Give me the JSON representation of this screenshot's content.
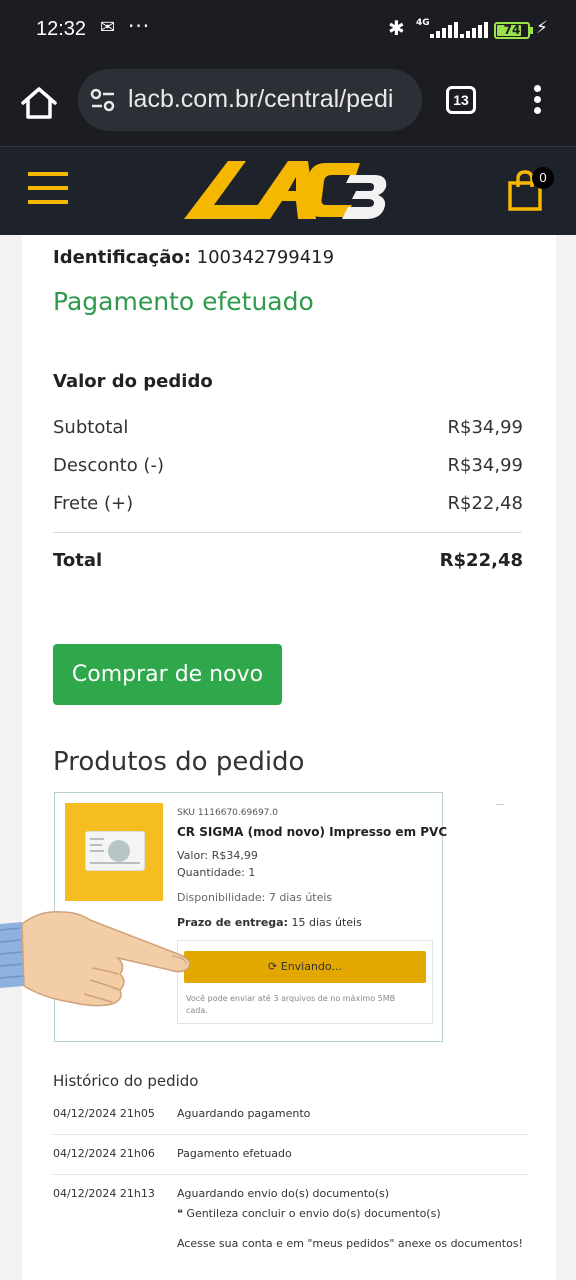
{
  "status_bar": {
    "time": "12:32",
    "network": "4G",
    "battery_level": "74",
    "battery_fraction": 0.74,
    "colors": {
      "background": "#1b1d22",
      "battery": "#9be34a"
    }
  },
  "browser": {
    "url": "lacb.com.br/central/pedi",
    "tab_count": "13"
  },
  "site_header": {
    "brand_color": "#f5b700",
    "cart_count": "0"
  },
  "order": {
    "identification_label": "Identificação:",
    "identification_value": "100342799419",
    "payment_status": "Pagamento efetuado",
    "summary_heading": "Valor do pedido",
    "rows": [
      {
        "label": "Subtotal",
        "value": "R$34,99"
      },
      {
        "label": "Desconto (-)",
        "value": "R$34,99"
      },
      {
        "label": "Frete (+)",
        "value": "R$22,48"
      }
    ],
    "total_label": "Total",
    "total_value": "R$22,48",
    "buy_again_label": "Comprar de novo",
    "products_heading": "Produtos do pedido"
  },
  "product": {
    "sku": "SKU 1116670.69697.0",
    "name": "CR SIGMA (mod novo) Impresso em PVC",
    "value": "Valor: R$34,99",
    "quantity": "Quantidade: 1",
    "availability": "Disponibilidade: 7 dias úteis",
    "delivery_label": "Prazo de entrega:",
    "delivery_value": "15 dias úteis",
    "send_button_label": "Enviando...",
    "upload_note": "Você pode enviar até 3 arquivos de no máximo 5MB cada."
  },
  "history": {
    "heading": "Histórico do pedido",
    "entries": [
      {
        "date": "04/12/2024 21h05",
        "status": "Aguardando pagamento"
      },
      {
        "date": "04/12/2024 21h06",
        "status": "Pagamento efetuado"
      },
      {
        "date": "04/12/2024 21h13",
        "status": "Aguardando envio do(s) documento(s)"
      }
    ],
    "note": "Gentileza concluir o envio do(s) documento(s)",
    "final_message": "Acesse sua conta e em \"meus pedidos\" anexe os documentos!"
  }
}
